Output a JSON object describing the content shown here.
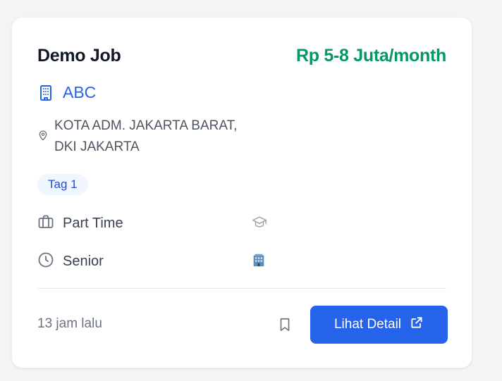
{
  "job": {
    "title": "Demo Job",
    "salary": "Rp 5-8 Juta/month",
    "company": "ABC",
    "location_line1": "KOTA ADM. JAKARTA BARAT,",
    "location_line2": "DKI JAKARTA",
    "tags": [
      "Tag 1"
    ],
    "job_type": "Part Time",
    "level": "Senior",
    "posted": "13 jam lalu"
  },
  "actions": {
    "detail_label": "Lihat Detail"
  },
  "icons": {
    "company": "building-icon",
    "location": "map-pin-icon",
    "job_type": "briefcase-icon",
    "level": "clock-icon",
    "education": "graduation-cap-icon",
    "office": "office-building-icon",
    "bookmark": "bookmark-icon",
    "external": "external-link-icon"
  },
  "colors": {
    "salary": "#059669",
    "company": "#2563eb",
    "button": "#2563eb",
    "tag_bg": "#eff6ff",
    "tag_text": "#1d4ed8"
  }
}
